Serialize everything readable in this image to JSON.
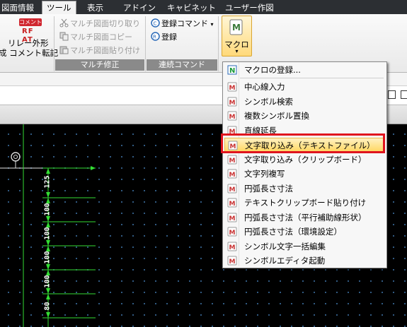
{
  "tabs": [
    "図面情報",
    "ツール",
    "表示",
    "アドイン",
    "キャビネット",
    "ユーザー作図"
  ],
  "active_tab": "ツール",
  "ribbon": {
    "comment_badge": "コメント",
    "relay_badge": "RF AT",
    "relay_line1": "リレー外形",
    "relay_line2": "成 コメント転記",
    "multi_cut": "マルチ図面切り取り",
    "multi_copy": "マルチ図面コピー",
    "multi_paste": "マルチ図面貼り付け",
    "group_multi": "マルチ修正",
    "reg_command": "登録コマンド",
    "register": "登録",
    "group_continuous": "連続コマンド",
    "macro_label": "マクロ"
  },
  "menu": {
    "header": "マクロの登録...",
    "items": [
      "中心線入力",
      "シンボル検索",
      "複数シンボル置換",
      "直線延長",
      "文字取り込み（テキストファイル）",
      "文字取り込み（クリップボード）",
      "文字列複写",
      "円弧長さ寸法",
      "テキストクリップボード貼り付け",
      "円弧長さ寸法（平行補助線形状）",
      "円弧長さ寸法（環境設定）",
      "シンボル文字一括編集",
      "シンボルエディタ起動"
    ],
    "highlighted_index": 4
  },
  "canvas": {
    "dimensions": [
      "125",
      "100",
      "100",
      "100",
      "100",
      "80"
    ]
  },
  "colors": {
    "highlight_border": "#e0141e",
    "dimension_line": "#33dd33"
  }
}
